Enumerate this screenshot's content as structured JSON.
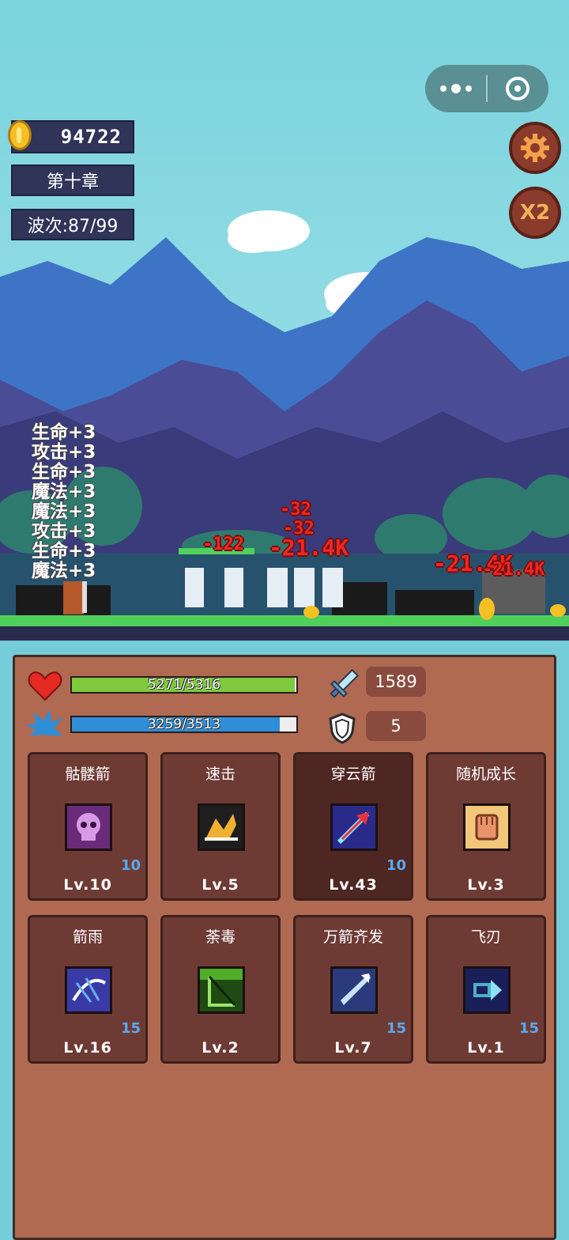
{
  "hud": {
    "gold": "94722",
    "chapter": "第十章",
    "wave": "波次:87/99",
    "x2_label": "X2"
  },
  "menu_capsule": {
    "more_icon": "more-dots-icon",
    "close_icon": "target-circle-icon"
  },
  "battle": {
    "buff_lines": [
      "生命+3",
      "攻击+3",
      "生命+3",
      "魔法+3",
      "魔法+3",
      "攻击+3",
      "生命+3",
      "魔法+3"
    ],
    "damage_numbers": [
      "-32",
      "-32",
      "-21.4K",
      "-122",
      "-21.4K",
      "-21.4K"
    ]
  },
  "stats": {
    "hp_text": "5271/5316",
    "hp_fraction": 0.9915,
    "mp_text": "3259/3513",
    "mp_fraction": 0.9277,
    "attack": "1589",
    "defense": "5",
    "colors": {
      "hp": "#7fc93d",
      "mp": "#2f8ed6"
    }
  },
  "skills": [
    {
      "name": "骷髅箭",
      "count": "10",
      "level": "Lv.10",
      "icon": "skull-icon",
      "color": "#b05cc7"
    },
    {
      "name": "速击",
      "count": "",
      "level": "Lv.5",
      "icon": "swift-boot-icon",
      "color": "#f0b030"
    },
    {
      "name": "穿云箭",
      "count": "10",
      "level": "Lv.43",
      "icon": "piercing-arrow-icon",
      "color": "#e8323c"
    },
    {
      "name": "随机成长",
      "count": "",
      "level": "Lv.3",
      "icon": "fist-icon",
      "color": "#e8936a"
    },
    {
      "name": "箭雨",
      "count": "15",
      "level": "Lv.16",
      "icon": "arrow-rain-icon",
      "color": "#6ab0f0"
    },
    {
      "name": "荼毒",
      "count": "",
      "level": "Lv.2",
      "icon": "poison-bow-icon",
      "color": "#4fae2a"
    },
    {
      "name": "万箭齐发",
      "count": "15",
      "level": "Lv.7",
      "icon": "arrow-volley-icon",
      "color": "#c8e4ff"
    },
    {
      "name": "飞刃",
      "count": "15",
      "level": "Lv.1",
      "icon": "flying-blade-icon",
      "color": "#4ab0c8"
    }
  ]
}
